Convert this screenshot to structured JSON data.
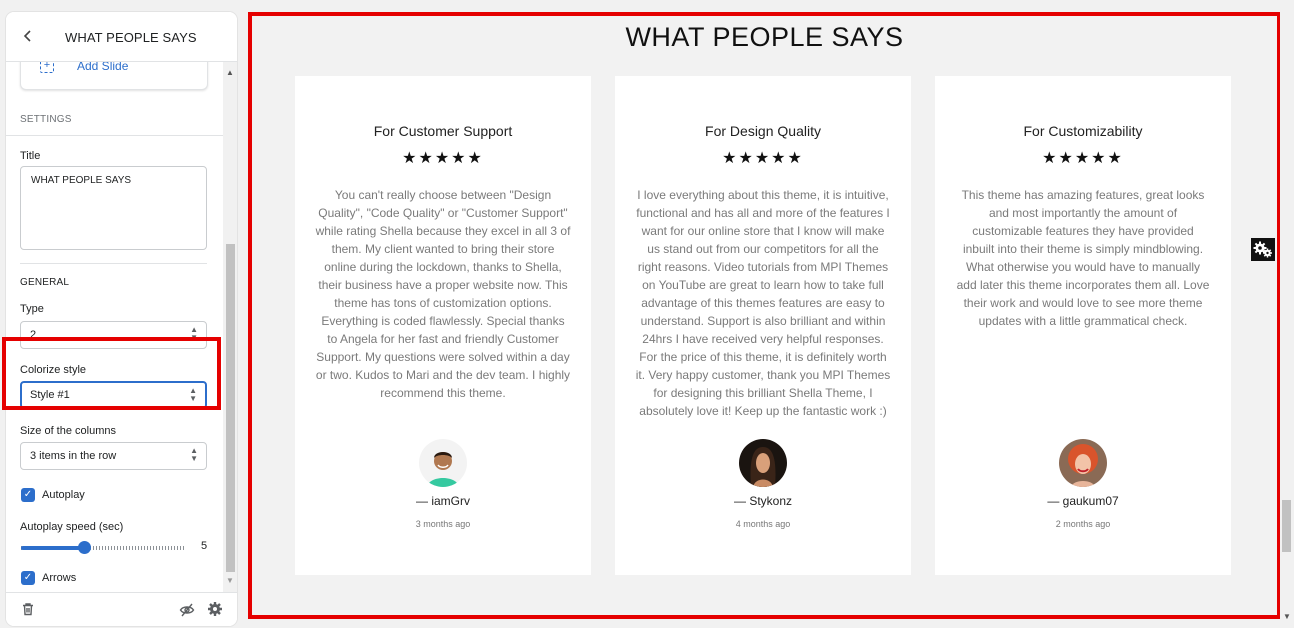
{
  "panel": {
    "back_icon": "chevron-left-icon",
    "title": "WHAT PEOPLE SAYS",
    "add_slide": {
      "icon": "add-slide-icon",
      "label": "Add Slide"
    },
    "settings_heading": "SETTINGS",
    "title_field": {
      "label": "Title",
      "value": "WHAT PEOPLE SAYS"
    },
    "general_heading": "GENERAL",
    "type_field": {
      "label": "Type",
      "value": "2"
    },
    "colorize_field": {
      "label": "Colorize style",
      "value": "Style #1"
    },
    "columns_field": {
      "label": "Size of the columns",
      "value": "3 items in the row"
    },
    "autoplay": {
      "label": "Autoplay",
      "checked": true
    },
    "autoplay_speed": {
      "label": "Autoplay speed (sec)",
      "value": "5",
      "fraction": 0.38
    },
    "arrows": {
      "label": "Arrows",
      "checked": true
    },
    "footer": {
      "delete_icon": "trash-icon",
      "hide_icon": "eye-off-icon",
      "settings_icon": "gear-icon"
    }
  },
  "preview": {
    "section_title": "WHAT PEOPLE SAYS",
    "testimonials": [
      {
        "heading": "For Customer Support",
        "stars": "★★★★★",
        "quote": "You can't really choose between \"Design Quality\", \"Code Quality\" or \"Customer Support\" while rating Shella because they excel in all 3 of them. My client wanted to bring their store online during the lockdown, thanks to Shella, their business have a proper website now. This theme has tons of customization options. Everything is coded flawlessly. Special thanks to Angela for her fast and friendly Customer Support. My questions were solved within a day or two. Kudos to Mari and the dev team. I highly recommend this theme.",
        "author": "— iamGrv",
        "time": "3 months ago"
      },
      {
        "heading": "For Design Quality",
        "stars": "★★★★★",
        "quote": "I love everything about this theme, it is intuitive, functional and has all and more of the features I want for our online store that I know will make us stand out from our competitors for all the right reasons. Video tutorials from MPI Themes on YouTube are great to learn how to take full advantage of this themes features are easy to understand. Support is also brilliant and within 24hrs I have received very helpful responses. For the price of this theme, it is definitely worth it. Very happy customer, thank you MPI Themes for designing this brilliant Shella Theme, I absolutely love it! Keep up the fantastic work :)",
        "author": "— Stykonz",
        "time": "4 months ago"
      },
      {
        "heading": "For Customizability",
        "stars": "★★★★★",
        "quote": "This theme has amazing features, great looks and most importantly the amount of customizable features they have provided inbuilt into their theme is simply mindblowing. What otherwise you would have to manually add later this theme incorporates them all. Love their work and would love to see more theme updates with a little grammatical check.",
        "author": "— gaukum07",
        "time": "2 months ago"
      }
    ],
    "floating_settings_icon": "gears-icon"
  },
  "colors": {
    "accent": "#2c6ecb",
    "highlight": "#e50000"
  }
}
